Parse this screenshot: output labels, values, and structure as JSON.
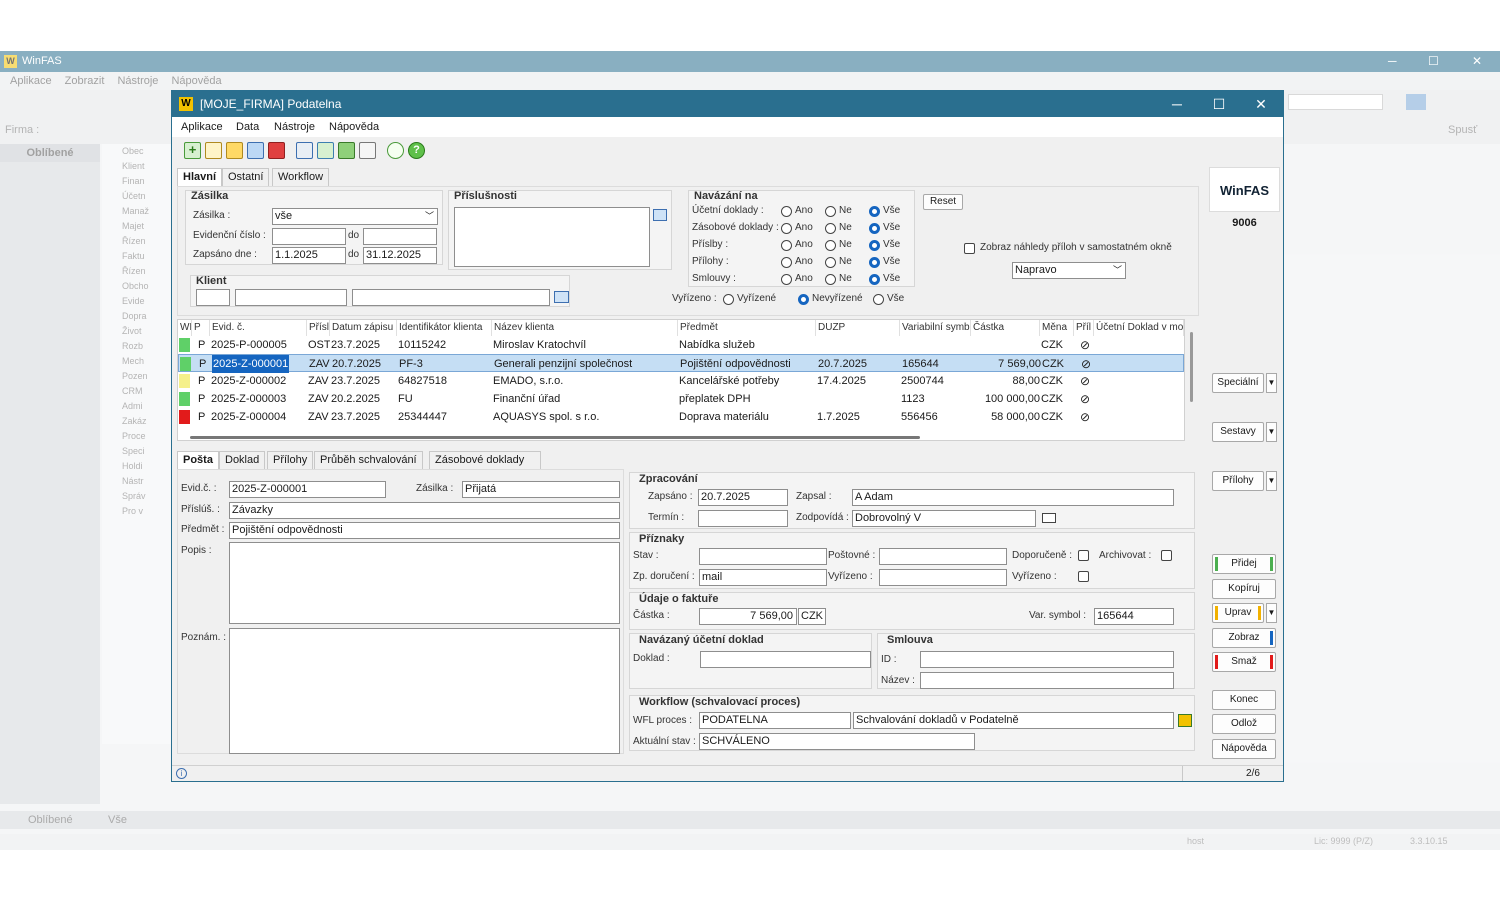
{
  "bg": {
    "title": "WinFAS",
    "menu": [
      "Aplikace",
      "Zobrazit",
      "Nástroje",
      "Nápověda"
    ],
    "firma_label": "Firma :",
    "oblibene": "Oblíbené",
    "tree": [
      "Obec",
      "Klient",
      "Finan",
      "Účetn",
      "Manaž",
      "Majet",
      "Řízen",
      "Faktu",
      "Řízen",
      "Obcho",
      "Evide",
      "Dopra",
      "Život",
      "Rozb",
      "Mech",
      "Pozen",
      "CRM",
      "Admi",
      "Zakáz",
      "Proce",
      "Speci",
      "Holdi",
      "Nástr",
      "Správ",
      "Pro v"
    ],
    "bottom_left": "Oblíbené",
    "bottom_right": "Vše",
    "spust": "Spusť",
    "status_host": "host",
    "status_lic": "Lic: 9999 (P/Z)",
    "status_ver": "3.3.10.15"
  },
  "window": {
    "title": "[MOJE_FIRMA] Podatelna",
    "min": "─",
    "max": "☐",
    "close": "✕",
    "menu": [
      "Aplikace",
      "Data",
      "Nástroje",
      "Nápověda"
    ]
  },
  "filter_tabs": [
    "Hlavní",
    "Ostatní",
    "Workflow"
  ],
  "zasilka": {
    "group": "Zásilka",
    "zasilka_label": "Zásilka :",
    "zasilka_value": "vše",
    "evid_label": "Evidenční číslo :",
    "do1": "do",
    "zapsano_label": "Zapsáno dne :",
    "zapsano_from": "1.1.2025",
    "do2": "do",
    "zapsano_to": "31.12.2025"
  },
  "prislusnosti": {
    "group": "Příslušnosti"
  },
  "klient": {
    "group": "Klient"
  },
  "navazani": {
    "group": "Navázání na",
    "rows": [
      {
        "label": "Účetní doklady :"
      },
      {
        "label": "Zásobové doklady :"
      },
      {
        "label": "Příslby :"
      },
      {
        "label": "Přílohy :"
      },
      {
        "label": "Smlouvy :"
      }
    ],
    "ano": "Ano",
    "ne": "Ne",
    "vse": "Vše",
    "reset": "Reset"
  },
  "vyrizeno": {
    "label": "Vyřízeno :",
    "opt1": "Vyřízené",
    "opt2": "Nevyřízené",
    "opt3": "Vše"
  },
  "preview": {
    "checkbox_label": "Zobraz náhledy příloh v samostatném okně",
    "select_value": "Napravo"
  },
  "grid": {
    "headers": [
      "WFO",
      "P",
      "Evid. č.",
      "Příslu",
      "Datum zápisu",
      "Identifikátor klienta",
      "Název klienta",
      "Předmět",
      "DUZP",
      "Variabilní symbol",
      "Částka",
      "Měna",
      "Příl",
      "Účetní Doklad v mo"
    ],
    "rows": [
      {
        "flag": "#5fd068",
        "p": "P",
        "evid": "2025-P-000005",
        "pris": "OST",
        "datum": "23.7.2025",
        "ident": "10115242",
        "nazev": "Miroslav Kratochvíl",
        "predmet": "Nabídka služeb",
        "duzp": "",
        "vs": "",
        "castka": "",
        "mena": "CZK"
      },
      {
        "flag": "#5fd068",
        "p": "P",
        "evid": "2025-Z-000001",
        "pris": "ZAV",
        "datum": "20.7.2025",
        "ident": "PF-3",
        "nazev": "Generali penzijní společnost",
        "predmet": "Pojištění odpovědnosti",
        "duzp": "20.7.2025",
        "vs": "165644",
        "castka": "7 569,00",
        "mena": "CZK"
      },
      {
        "flag": "#f5f08a",
        "p": "P",
        "evid": "2025-Z-000002",
        "pris": "ZAV",
        "datum": "23.7.2025",
        "ident": "64827518",
        "nazev": "EMADO, s.r.o.",
        "predmet": "Kancelářské potřeby",
        "duzp": "17.4.2025",
        "vs": "2500744",
        "castka": "88,00",
        "mena": "CZK"
      },
      {
        "flag": "#5fd068",
        "p": "P",
        "evid": "2025-Z-000003",
        "pris": "ZAV",
        "datum": "20.2.2025",
        "ident": "FU",
        "nazev": "Finanční úřad",
        "predmet": "přeplatek DPH",
        "duzp": "",
        "vs": "1123",
        "castka": "100 000,00",
        "mena": "CZK"
      },
      {
        "flag": "#e21b1b",
        "p": "P",
        "evid": "2025-Z-000004",
        "pris": "ZAV",
        "datum": "23.7.2025",
        "ident": "25344447",
        "nazev": "AQUASYS spol. s r.o.",
        "predmet": "Doprava materiálu",
        "duzp": "1.7.2025",
        "vs": "556456",
        "castka": "58 000,00",
        "mena": "CZK"
      }
    ]
  },
  "detail_tabs": [
    "Pošta",
    "Doklad",
    "Přílohy",
    "Průběh schvalování",
    "Zásobové doklady"
  ],
  "detail": {
    "evid_label": "Evid.č. :",
    "evid": "2025-Z-000001",
    "zasilka_label": "Zásilka :",
    "zasilka": "Přijatá",
    "prislus_label": "Příslúš. :",
    "prislus": "Závazky",
    "predmet_label": "Předmět :",
    "predmet": "Pojištění odpovědnosti",
    "popis_label": "Popis :",
    "poznam_label": "Poznám. :"
  },
  "zpracovani": {
    "group": "Zpracování",
    "zapsano_label": "Zapsáno :",
    "zapsano": "20.7.2025",
    "zapsal_label": "Zapsal :",
    "zapsal": "A Adam",
    "termin_label": "Termín :",
    "zodpovida_label": "Zodpovídá :",
    "zodpovida": "Dobrovolný V"
  },
  "priznaky": {
    "group": "Příznaky",
    "stav_label": "Stav :",
    "postovne_label": "Poštovné :",
    "doporucene_label": "Doporučeně :",
    "archivovat_label": "Archivovat :",
    "zp_label": "Zp. doručení :",
    "zp": "mail",
    "vyrizeno_label": "Vyřízeno :",
    "vyrizeno2_label": "Vyřízeno :"
  },
  "faktura": {
    "group": "Údaje o faktuře",
    "castka_label": "Částka :",
    "castka": "7 569,00",
    "mena": "CZK",
    "vs_label": "Var. symbol :",
    "vs": "165644"
  },
  "ucetni": {
    "group": "Navázaný účetní doklad",
    "doklad_label": "Doklad :"
  },
  "smlouva": {
    "group": "Smlouva",
    "id_label": "ID :",
    "nazev_label": "Název :"
  },
  "workflow": {
    "group": "Workflow (schvalovací proces)",
    "proces_label": "WFL proces :",
    "proces": "PODATELNA",
    "proces_desc": "Schvalování dokladů v Podatelně",
    "stav_label": "Aktuální stav :",
    "stav": "SCHVÁLENO"
  },
  "right": {
    "logo": "WinFAS",
    "code": "9006",
    "specialni": "Speciální",
    "sestavy": "Sestavy",
    "prilohy": "Přílohy",
    "pridej": "Přidej",
    "kopiruj": "Kopíruj",
    "uprav": "Uprav",
    "zobraz": "Zobraz",
    "smaz": "Smaž",
    "konec": "Konec",
    "odloz": "Odlož",
    "napoveda": "Nápověda"
  },
  "status": {
    "info_icon": "i",
    "pager": "2/6"
  },
  "colors": {
    "accent": "#2a6f8f",
    "selected_row": "#c5def4",
    "radio_on": "#1565c0"
  }
}
